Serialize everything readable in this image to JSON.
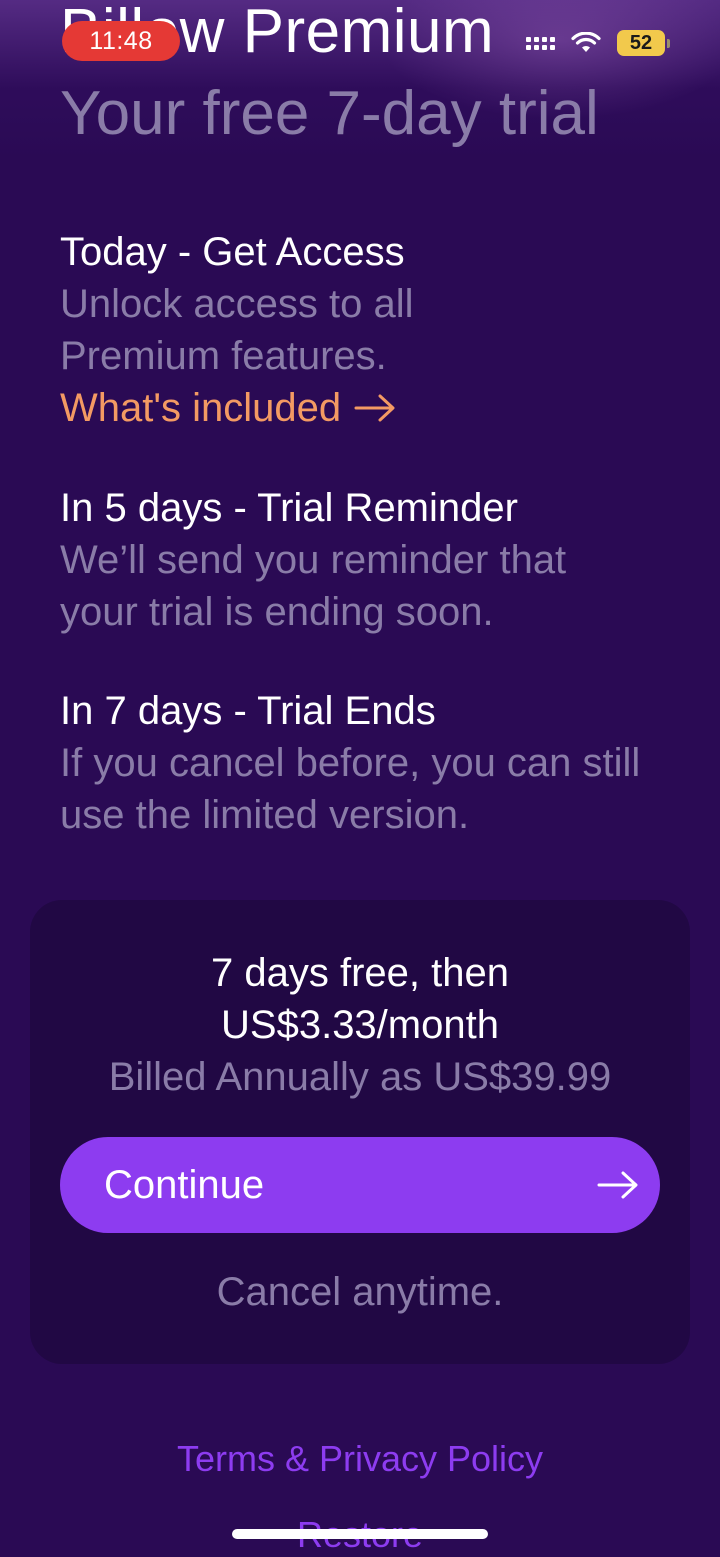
{
  "status_bar": {
    "time": "11:48",
    "battery": "52"
  },
  "header": {
    "title": "Billow Premium",
    "subtitle": "Your free 7-day trial"
  },
  "timeline": [
    {
      "heading": "Today - Get Access",
      "body_lines": [
        "Unlock access to all",
        "Premium features."
      ],
      "link": "What's included"
    },
    {
      "heading": "In 5 days - Trial Reminder",
      "body_lines": [
        "We’ll send you reminder that",
        "your trial is ending soon."
      ]
    },
    {
      "heading": "In 7 days - Trial Ends",
      "body_lines": [
        "If you cancel before, you can still",
        "use the limited version."
      ]
    }
  ],
  "offer": {
    "line1": "7 days free, then",
    "line2": "US$3.33/month",
    "billing": "Billed Annually as US$39.99",
    "continue_label": "Continue",
    "cancel_note": "Cancel anytime."
  },
  "footer": {
    "terms_link": "Terms & Privacy Policy",
    "restore_link": "Restore"
  },
  "colors": {
    "background": "#2a0a54",
    "card": "#210844",
    "accent_purple": "#8d3cf0",
    "link_orange": "#f39a63",
    "muted_text": "#8a7ca8",
    "time_pill": "#e53935",
    "battery": "#f2c94c"
  },
  "icons": {
    "link_arrow": "arrow-right-icon",
    "continue_arrow": "arrow-right-icon",
    "signal": "cellular-signal-icon",
    "wifi": "wifi-icon",
    "battery": "battery-icon"
  }
}
